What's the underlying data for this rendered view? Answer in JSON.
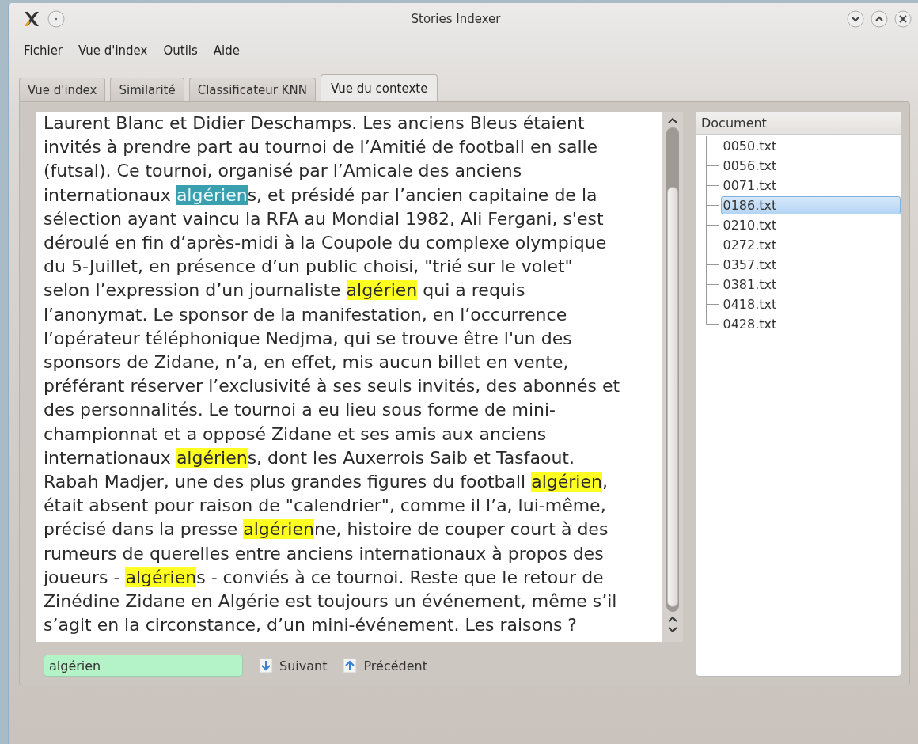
{
  "window": {
    "title": "Stories Indexer"
  },
  "menu": [
    "Fichier",
    "Vue d'index",
    "Outils",
    "Aide"
  ],
  "tabs": [
    {
      "label": "Vue d'index",
      "selected": false
    },
    {
      "label": "Similarité",
      "selected": false
    },
    {
      "label": "Classificateur KNN",
      "selected": false
    },
    {
      "label": "Vue du contexte",
      "selected": true
    }
  ],
  "text_lines": [
    [
      {
        "text": "Laurent Blanc et Didier Deschamps. Les anciens Bleus étaient",
        "kind": "plain"
      }
    ],
    [
      {
        "text": "invités à prendre part au tournoi de l’Amitié de football en salle",
        "kind": "plain"
      }
    ],
    [
      {
        "text": "(futsal). Ce tournoi, organisé par l’Amicale des anciens",
        "kind": "plain"
      }
    ],
    [
      {
        "text": "internationaux ",
        "kind": "plain"
      },
      {
        "text": "algérien",
        "kind": "current"
      },
      {
        "text": "s, et présidé par l’ancien capitaine de la",
        "kind": "plain"
      }
    ],
    [
      {
        "text": "sélection ayant vaincu la RFA au Mondial 1982, Ali Fergani, s'est",
        "kind": "plain"
      }
    ],
    [
      {
        "text": "déroulé en fin d’après-midi à la Coupole du complexe olympique",
        "kind": "plain"
      }
    ],
    [
      {
        "text": "du 5-Juillet, en présence d’un public choisi, \"trié sur le volet\"",
        "kind": "plain"
      }
    ],
    [
      {
        "text": "selon l’expression d’un journaliste ",
        "kind": "plain"
      },
      {
        "text": "algérien",
        "kind": "match"
      },
      {
        "text": " qui a requis",
        "kind": "plain"
      }
    ],
    [
      {
        "text": "l’anonymat. Le sponsor de la manifestation, en l’occurrence",
        "kind": "plain"
      }
    ],
    [
      {
        "text": "l’opérateur téléphonique Nedjma, qui se trouve être l'un des",
        "kind": "plain"
      }
    ],
    [
      {
        "text": "sponsors de Zidane, n’a, en effet, mis aucun billet en vente,",
        "kind": "plain"
      }
    ],
    [
      {
        "text": "préférant réserver l’exclusivité à ses seuls invités, des abonnés et",
        "kind": "plain"
      }
    ],
    [
      {
        "text": "des personnalités. Le tournoi a eu lieu sous forme de mini-",
        "kind": "plain"
      }
    ],
    [
      {
        "text": "championnat et a opposé Zidane et ses amis aux anciens",
        "kind": "plain"
      }
    ],
    [
      {
        "text": "internationaux ",
        "kind": "plain"
      },
      {
        "text": "algérien",
        "kind": "match"
      },
      {
        "text": "s, dont les Auxerrois Saib et Tasfaout.",
        "kind": "plain"
      }
    ],
    [
      {
        "text": "Rabah Madjer, une des plus grandes figures du football ",
        "kind": "plain"
      },
      {
        "text": "algérien",
        "kind": "match"
      },
      {
        "text": ",",
        "kind": "plain"
      }
    ],
    [
      {
        "text": "était absent pour raison de \"calendrier\", comme il l’a, lui-même,",
        "kind": "plain"
      }
    ],
    [
      {
        "text": "précisé dans la presse ",
        "kind": "plain"
      },
      {
        "text": "algérien",
        "kind": "match"
      },
      {
        "text": "ne, histoire de couper court à des",
        "kind": "plain"
      }
    ],
    [
      {
        "text": "rumeurs de querelles entre anciens internationaux à propos des",
        "kind": "plain"
      }
    ],
    [
      {
        "text": "joueurs - ",
        "kind": "plain"
      },
      {
        "text": "algérien",
        "kind": "match"
      },
      {
        "text": "s - conviés à ce tournoi. Reste que le retour de",
        "kind": "plain"
      }
    ],
    [
      {
        "text": "Zinédine Zidane en Algérie est toujours un événement, même s’il",
        "kind": "plain"
      }
    ],
    [
      {
        "text": "s’agit en la circonstance, d’un mini-événement. Les raisons ?",
        "kind": "plain"
      }
    ]
  ],
  "search": {
    "value": "algérien",
    "found": true
  },
  "buttons": [
    {
      "label": "Suivant",
      "kind": "down"
    },
    {
      "label": "Précédent",
      "kind": "up"
    }
  ],
  "tree": {
    "header": "Document",
    "items": [
      {
        "label": "0050.txt",
        "selected": false
      },
      {
        "label": "0056.txt",
        "selected": false
      },
      {
        "label": "0071.txt",
        "selected": false
      },
      {
        "label": "0186.txt",
        "selected": true
      },
      {
        "label": "0210.txt",
        "selected": false
      },
      {
        "label": "0272.txt",
        "selected": false
      },
      {
        "label": "0357.txt",
        "selected": false
      },
      {
        "label": "0381.txt",
        "selected": false
      },
      {
        "label": "0418.txt",
        "selected": false
      },
      {
        "label": "0428.txt",
        "selected": false
      }
    ]
  }
}
